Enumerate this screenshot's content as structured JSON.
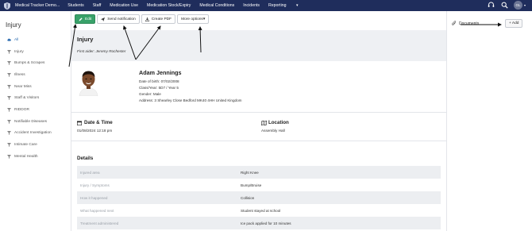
{
  "topbar": {
    "brand": "Medical Tracker Demo...",
    "nav": [
      "Students",
      "Staff",
      "Medication Use",
      "Medication Stock/Expiry",
      "Medical Conditions",
      "Incidents",
      "Reporting"
    ],
    "avatar_initials": "GL",
    "bg_color": "#1f2d5c"
  },
  "sidebar": {
    "title": "Injury",
    "items": [
      {
        "label": "All"
      },
      {
        "label": "Injury"
      },
      {
        "label": "Bumps & Scrapes"
      },
      {
        "label": "Illness"
      },
      {
        "label": "Near Miss"
      },
      {
        "label": "Staff & Visitors"
      },
      {
        "label": "RIDDOR"
      },
      {
        "label": "Notifiable Diseases"
      },
      {
        "label": "Accident Investigation"
      },
      {
        "label": "Intimate Care"
      },
      {
        "label": "Mental Health"
      }
    ]
  },
  "toolbar": {
    "edit": "Edit",
    "send_notification": "Send notification",
    "create_pdf": "Create PDF",
    "more_options": "More options"
  },
  "incident": {
    "title": "Injury",
    "first_aider": "First aider: Jeremy Rochester"
  },
  "student": {
    "name": "Adam Jennings",
    "dob": "Date of birth: 07/02/2008",
    "class_year": "Class/Year: 5D7 / Year 5",
    "gender": "Gender: Male",
    "address": "Address: 3 Shearley Close Bedford MK40 4HH United Kingdom"
  },
  "date_time": {
    "title": "Date & Time",
    "value": "01/08/2024 12:18 pm"
  },
  "location": {
    "title": "Location",
    "value": "Assembly Hall"
  },
  "details": {
    "title": "Details",
    "rows": [
      {
        "label": "Injured area",
        "value": "Right Knee"
      },
      {
        "label": "Injury / Symptoms",
        "value": "Bump/Bruise"
      },
      {
        "label": "How it happened",
        "value": "Collision"
      },
      {
        "label": "What happened next",
        "value": "Student stayed at school"
      },
      {
        "label": "Treatment administered",
        "value": "Ice pack applied for 10 minutes"
      }
    ]
  },
  "documents": {
    "label": "Documents",
    "add": "+ Add"
  },
  "colors": {
    "accent_green": "#38a169",
    "active_link": "#2b6cb0"
  }
}
